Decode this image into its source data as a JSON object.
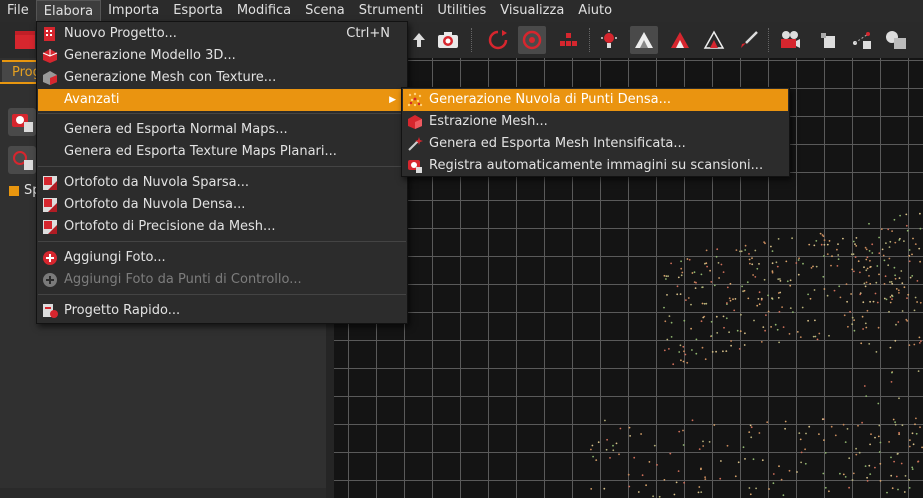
{
  "menubar": {
    "items": [
      "File",
      "Elabora",
      "Importa",
      "Esporta",
      "Modifica",
      "Scena",
      "Strumenti",
      "Utilities",
      "Visualizza",
      "Aiuto"
    ]
  },
  "left_panel": {
    "tab_label": "Prog",
    "item_label": "Sp"
  },
  "elabora_menu": {
    "items": [
      {
        "label": "Nuovo Progetto...",
        "shortcut": "Ctrl+N",
        "icon": "new-project-icon"
      },
      {
        "label": "Generazione Modello 3D...",
        "icon": "model-3d-icon"
      },
      {
        "label": "Generazione Mesh con Texture...",
        "icon": "textured-mesh-icon"
      },
      {
        "label": "Avanzati",
        "icon": "",
        "highlighted": true,
        "submenu": true
      },
      {
        "label": "Genera ed Esporta Normal Maps...",
        "icon": ""
      },
      {
        "label": "Genera ed Esporta Texture Maps Planari...",
        "icon": ""
      },
      {
        "label": "Ortofoto da Nuvola Sparsa...",
        "icon": "orthophoto-icon"
      },
      {
        "label": "Ortofoto da Nuvola Densa...",
        "icon": "orthophoto-icon"
      },
      {
        "label": "Ortofoto di Precisione da Mesh...",
        "icon": "orthophoto-icon"
      },
      {
        "label": "Aggiungi Foto...",
        "icon": "add-icon"
      },
      {
        "label": "Aggiungi Foto da Punti di Controllo...",
        "icon": "add-icon",
        "disabled": true
      },
      {
        "label": "Progetto Rapido...",
        "icon": "quick-project-icon"
      }
    ]
  },
  "avanzati_submenu": {
    "items": [
      {
        "label": "Generazione Nuvola di Punti Densa...",
        "icon": "dense-cloud-icon",
        "highlighted": true
      },
      {
        "label": "Estrazione Mesh...",
        "icon": "mesh-extract-icon"
      },
      {
        "label": "Genera ed Esporta Mesh Intensificata...",
        "icon": "wand-icon"
      },
      {
        "label": "Registra automaticamente immagini su scansioni...",
        "icon": "register-images-icon"
      }
    ]
  },
  "colors": {
    "accent": "#ea9410",
    "menu_bg": "#2c2c2c",
    "icon_red": "#e0303a"
  }
}
